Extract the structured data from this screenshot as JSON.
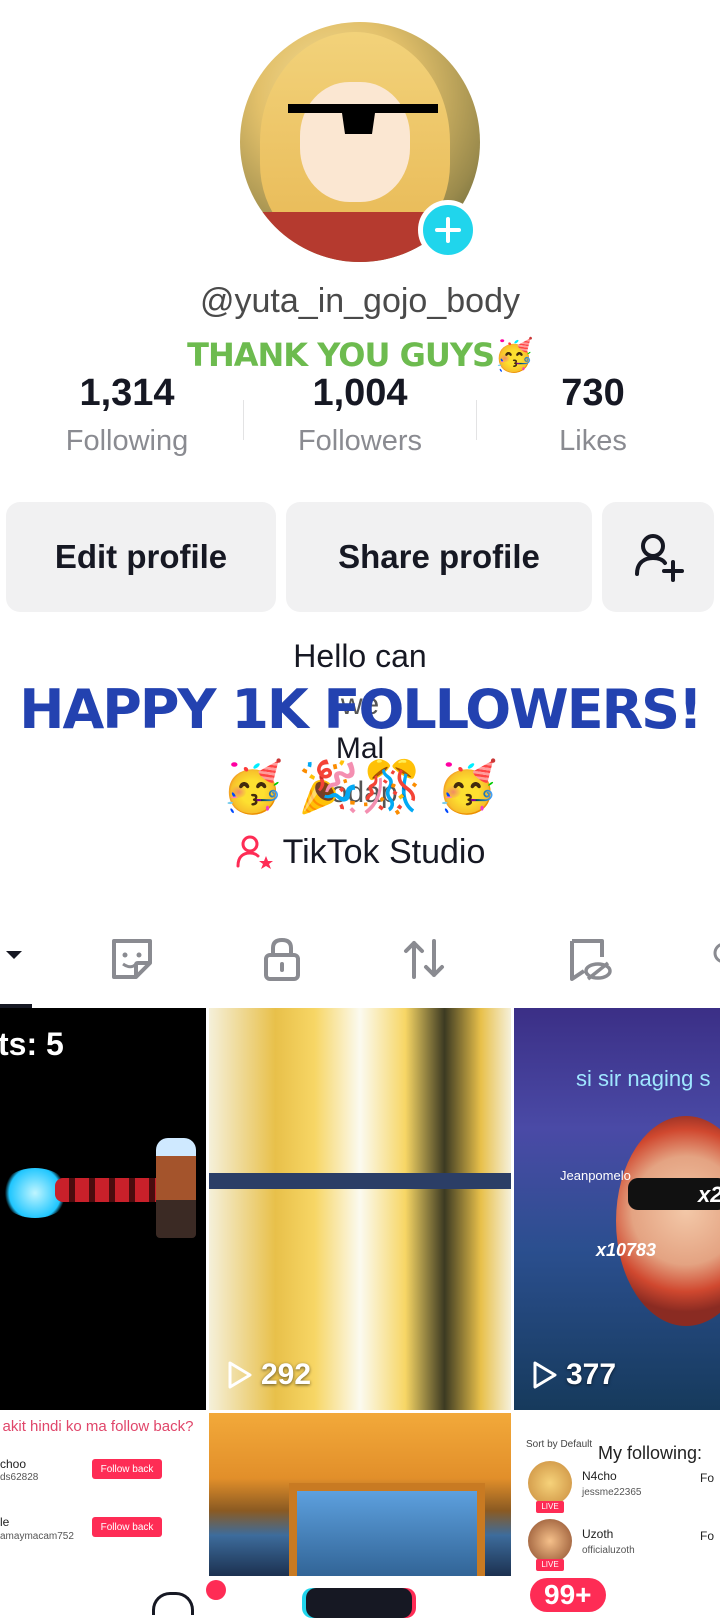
{
  "profile": {
    "username": "@yuta_in_gojo_body",
    "banner": "THANK YOU GUYS🥳"
  },
  "stats": [
    {
      "value": "1,314",
      "label": "Following"
    },
    {
      "value": "1,004",
      "label": "Followers"
    },
    {
      "value": "730",
      "label": "Likes"
    }
  ],
  "buttons": {
    "edit": "Edit profile",
    "share": "Share profile"
  },
  "bio": {
    "line1": "Hello can",
    "line2": "we",
    "line3": "Mal",
    "line4": "todap",
    "happy": "HAPPY 1K FOLLOWERS!",
    "emojis": "🥳 🎉🎊 🥳"
  },
  "studio": {
    "label": "TikTok Studio"
  },
  "grid": {
    "cell1_caption": "ts: 5",
    "cell2_views": "292",
    "cell3_top_text": "si sir naging s",
    "cell3_name": "Jeanpomelo",
    "cell3_gift": "x10783",
    "cell3_x2": "x2",
    "cell3_views": "377",
    "cell4_title": "akit hindi ko ma follow back?",
    "cell4_user1": "choo",
    "cell4_user1_id": "ds62828",
    "cell4_user2": "le",
    "cell4_user2_id": "amaymacam752",
    "cell4_follow_back": "Follow back",
    "cell6_heading": "My following:",
    "cell6_sort": "Sort by Default",
    "cell6_user1": "N4cho",
    "cell6_user1_id": "jessme22365",
    "cell6_user2": "Uzoth",
    "cell6_user2_id": "officialuzoth",
    "cell6_live": "LIVE",
    "cell6_fo": "Fo"
  },
  "nav": {
    "inbox_badge": "99+"
  },
  "colors": {
    "accent_cyan": "#20d5ec",
    "tiktok_red": "#fe2c55",
    "banner_green": "#6dbb4f",
    "happy_blue": "#2342b0"
  }
}
